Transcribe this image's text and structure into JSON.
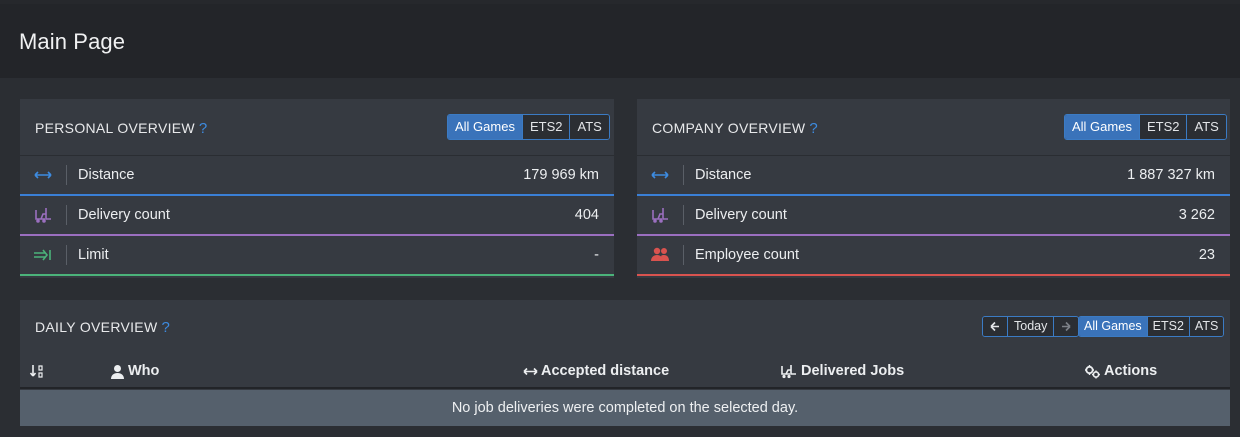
{
  "header": {
    "title": "Main Page"
  },
  "game_filters": [
    "All Games",
    "ETS2",
    "ATS"
  ],
  "help_mark": "?",
  "personal": {
    "title": "PERSONAL OVERVIEW",
    "rows": [
      {
        "icon": "arrows-horizontal-icon",
        "label": "Distance",
        "value": "179 969 km"
      },
      {
        "icon": "forklift-icon",
        "label": "Delivery count",
        "value": "404"
      },
      {
        "icon": "arrow-to-line-icon",
        "label": "Limit",
        "value": "-"
      }
    ]
  },
  "company": {
    "title": "COMPANY OVERVIEW",
    "rows": [
      {
        "icon": "arrows-horizontal-icon",
        "label": "Distance",
        "value": "1 887 327 km"
      },
      {
        "icon": "forklift-icon",
        "label": "Delivery count",
        "value": "3 262"
      },
      {
        "icon": "users-icon",
        "label": "Employee count",
        "value": "23"
      }
    ]
  },
  "daily": {
    "title": "DAILY OVERVIEW",
    "nav": {
      "today_label": "Today"
    },
    "columns": [
      "Who",
      "Accepted distance",
      "Delivered Jobs",
      "Actions"
    ],
    "empty_message": "No job deliveries were completed on the selected day."
  },
  "colors": {
    "accent": "#3a73ba",
    "distance": "#3a7fd6",
    "delivery": "#9b6fc0",
    "limit": "#4bb37a",
    "employees": "#d9534f"
  }
}
